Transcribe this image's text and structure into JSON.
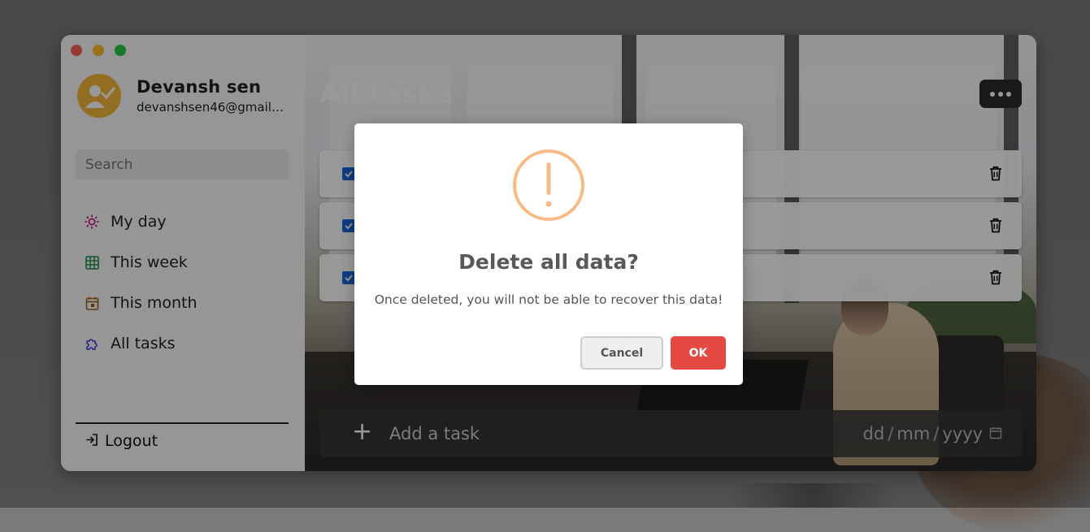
{
  "colors": {
    "traffic_close": "#ff5f57",
    "traffic_min": "#febc2e",
    "traffic_max": "#28c840",
    "avatar_bg": "#f6b83a",
    "ok_button": "#e64942",
    "warning_icon": "#f8bb86",
    "checkbox": "#1a66d9"
  },
  "sidebar": {
    "user_name": "Devansh sen",
    "user_email": "devanshsen46@gmail.com",
    "search_placeholder": "Search",
    "nav": [
      {
        "label": "My day",
        "icon": "sun-icon"
      },
      {
        "label": "This week",
        "icon": "grid-calendar-icon"
      },
      {
        "label": "This month",
        "icon": "calendar-icon"
      },
      {
        "label": "All tasks",
        "icon": "puzzle-icon"
      }
    ],
    "logout_label": "Logout"
  },
  "main": {
    "title": "All tasks",
    "tasks": [
      {
        "text": "",
        "done": true
      },
      {
        "text": "",
        "done": true
      },
      {
        "text": "",
        "done": true
      }
    ],
    "add_task_placeholder": "Add a task",
    "date_placeholder": {
      "day": "dd",
      "month": "mm",
      "year": "yyyy"
    }
  },
  "dialog": {
    "title": "Delete all data?",
    "message": "Once deleted, you will not be able to recover this data!",
    "cancel_label": "Cancel",
    "ok_label": "OK"
  }
}
